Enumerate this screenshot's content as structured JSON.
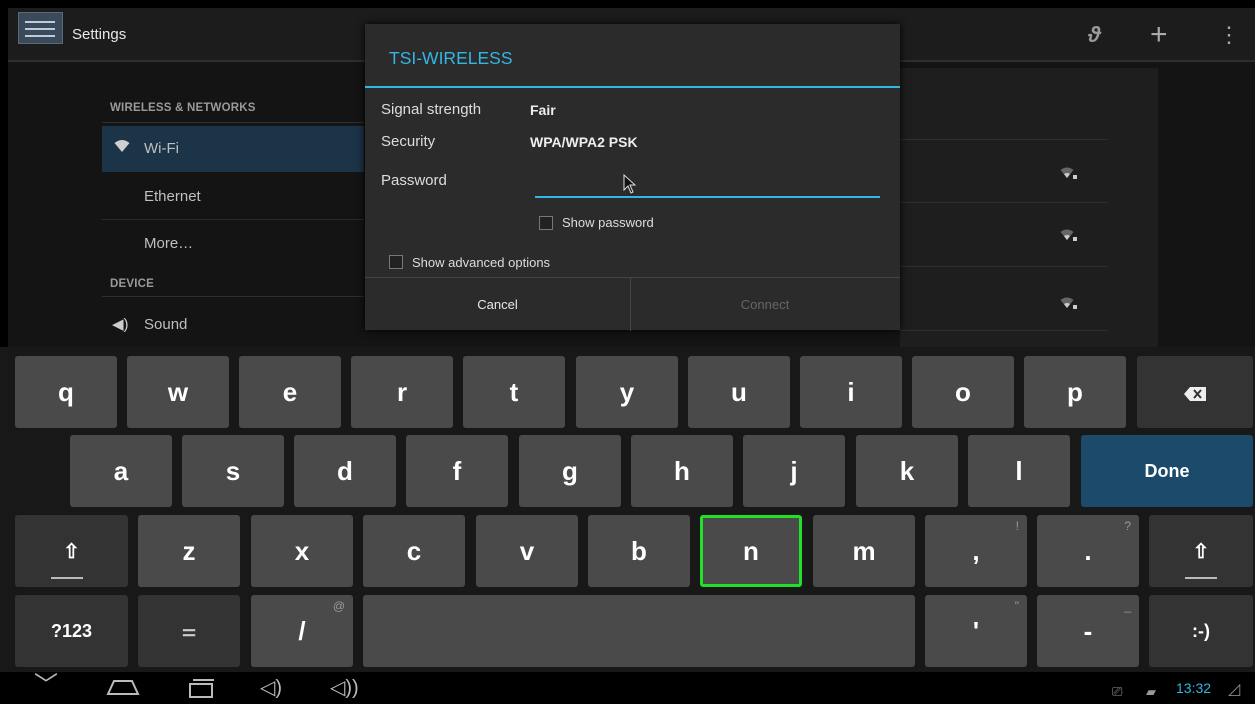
{
  "app": {
    "title": "Settings",
    "icon": "settings-sliders-icon"
  },
  "topbar_icons": [
    "sync-icon",
    "add-icon",
    "overflow-menu-icon"
  ],
  "settings": {
    "sections": [
      {
        "header": "WIRELESS & NETWORKS",
        "items": [
          {
            "label": "Wi-Fi",
            "icon": "wifi-icon",
            "selected": true
          },
          {
            "label": "Ethernet"
          },
          {
            "label": "More…"
          }
        ]
      },
      {
        "header": "DEVICE",
        "items": [
          {
            "label": "Sound",
            "icon": "speaker-icon"
          }
        ]
      }
    ]
  },
  "dialog": {
    "title": "TSI-WIRELESS",
    "signal_label": "Signal strength",
    "signal_value": "Fair",
    "security_label": "Security",
    "security_value": "WPA/WPA2 PSK",
    "password_label": "Password",
    "password_value": "",
    "show_password": "Show password",
    "show_advanced": "Show advanced options",
    "cancel": "Cancel",
    "connect": "Connect"
  },
  "keyboard": {
    "row1": [
      "q",
      "w",
      "e",
      "r",
      "t",
      "y",
      "u",
      "i",
      "o",
      "p"
    ],
    "row2": [
      "a",
      "s",
      "d",
      "f",
      "g",
      "h",
      "j",
      "k",
      "l"
    ],
    "done": "Done",
    "row3": [
      "z",
      "x",
      "c",
      "v",
      "b",
      "n",
      "m"
    ],
    "comma": ",",
    "comma_hint": "!",
    "period": ".",
    "period_hint": "?",
    "symbols": "?123",
    "slash": "/",
    "slash_hint": "@",
    "apostrophe": "'",
    "apostrophe_hint": "\"",
    "dash": "-",
    "dash_hint": "_",
    "smiley": ":-)",
    "highlighted_key": "n"
  },
  "status": {
    "time": "13:32"
  },
  "colors": {
    "accent": "#33b5e5",
    "highlight": "#22e02a",
    "done_key": "#1b4a6b"
  }
}
